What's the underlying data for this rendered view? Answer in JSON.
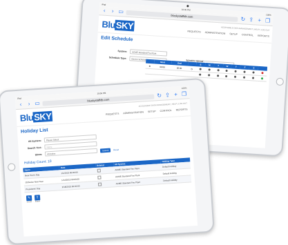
{
  "back_screen": {
    "status": {
      "carrier": "iPad",
      "time": "10:06 PM",
      "battery": "100%"
    },
    "url": "bluskystaffdb.com",
    "topline": "ACCESSIBLE DATA MANAGEMENT | HELP | LOG OUT",
    "logo": {
      "text1": "Blu",
      "text2": "SKY"
    },
    "menu": [
      "REQUESTS",
      "ADMINISTRATION",
      "SETUP",
      "CONTROL",
      "REPORTS"
    ],
    "page_title": "Edit Schedule",
    "system_label": "System:",
    "system_value": "ACME Standard Fire Plant",
    "type_label": "Schedule Type:",
    "type_value": "Device Schedule",
    "name_label": "Name:",
    "name_value": "8 Shift ADHV Operations",
    "interval_label": "Schedule Interval",
    "columns": [
      "",
      "Start",
      "End",
      "",
      "S",
      "M",
      "T",
      "W",
      "T",
      "F",
      "S",
      ""
    ],
    "row": {
      "start": "00:00",
      "end": "06:00"
    }
  },
  "front_screen": {
    "status": {
      "carrier": "iPad",
      "time": "10:06 PM",
      "battery": "100%"
    },
    "url": "bluskystaffdb.com",
    "topline": "ACCESSIBLE DATA MANAGEMENT | HELP | LOG OUT",
    "logo": {
      "text1": "Blu",
      "text2": "SKY"
    },
    "menu": [
      "REQUESTS",
      "ADMINISTRATION",
      "SETUP",
      "CONTROL",
      "REPORTS"
    ],
    "page_title": "Holiday List",
    "filters": {
      "system_label": "All System:",
      "system_value": "Please Select",
      "search_label": "Search Text:",
      "search_placeholder": "Name",
      "show_label": "Show:",
      "show_value": "All Active",
      "submit_label": "Submit",
      "reset_label": "Reset"
    },
    "count_caption": "Holiday Count: 10",
    "table": {
      "headers": [
        "Name",
        "Date",
        "Deleted",
        "Alt System",
        "Holiday Type"
      ],
      "rows": [
        [
          "New Year's Day",
          "1/1/2013\n00:00:00",
          "",
          "ACME Standard Fire Plant",
          "Default Holiday"
        ],
        [
          "Orthodox New Year",
          "1/14/2013\n00:00:00",
          "",
          "ACME Standard Fire Plant",
          "Default Holiday"
        ],
        [
          "Presidents' Day",
          "2/18/2013\n00:00:00",
          "",
          "ACME Standard Fire Plant",
          "Default Holiday"
        ]
      ]
    },
    "icons": [
      {
        "name": "create-icon",
        "glyph": "✎",
        "label": "Create"
      },
      {
        "name": "export-icon",
        "glyph": "⇪",
        "label": "Export"
      }
    ]
  }
}
